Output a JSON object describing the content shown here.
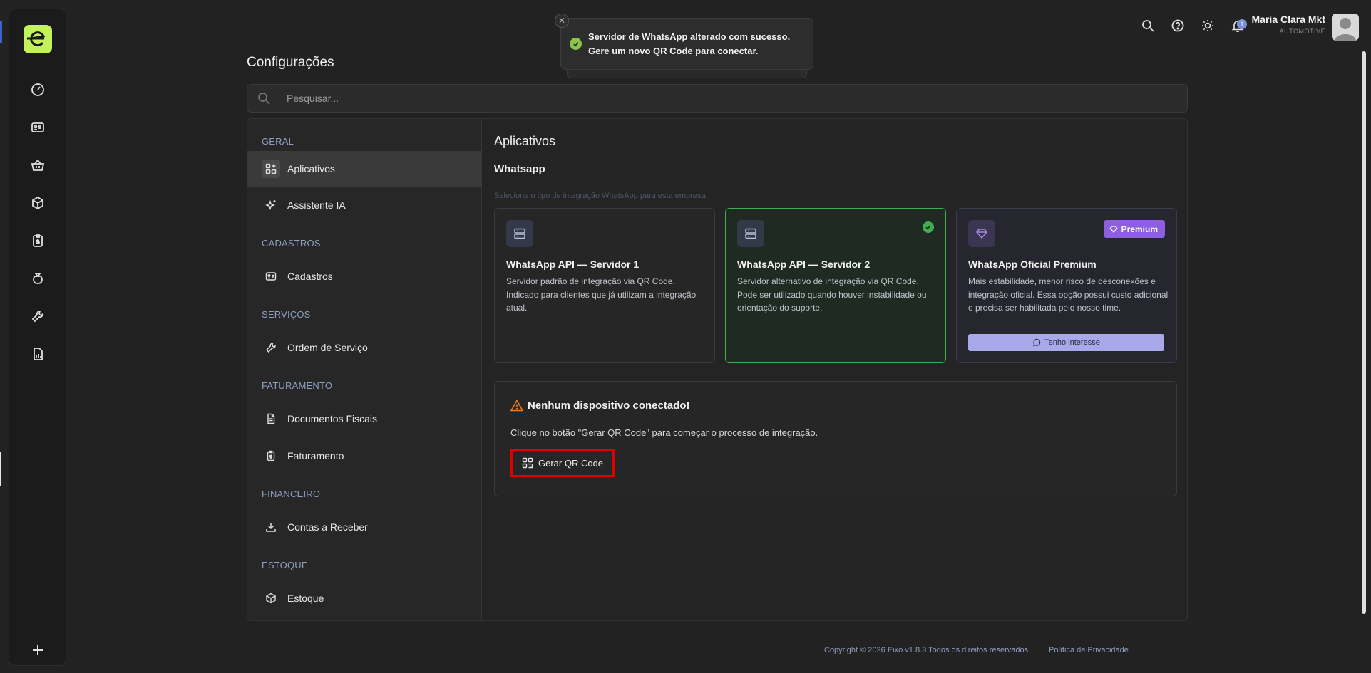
{
  "user": {
    "name": "Maria Clara Mkt",
    "company": "AUTOMOTIVE",
    "notifications": "1"
  },
  "toast": {
    "message": "Servidor de WhatsApp alterado com sucesso. Gere um novo QR Code para conectar.",
    "close": "✕"
  },
  "page": {
    "title": "Configurações"
  },
  "search": {
    "placeholder": "Pesquisar..."
  },
  "sidebar": {
    "sections": [
      {
        "label": "GERAL"
      },
      {
        "label": "CADASTROS"
      },
      {
        "label": "SERVIÇOS"
      },
      {
        "label": "FATURAMENTO"
      },
      {
        "label": "FINANCEIRO"
      },
      {
        "label": "ESTOQUE"
      }
    ],
    "items": [
      {
        "label": "Aplicativos",
        "icon": "apps-icon"
      },
      {
        "label": "Assistente IA",
        "icon": "sparkles-icon"
      },
      {
        "label": "Cadastros",
        "icon": "id-card-icon"
      },
      {
        "label": "Ordem de Serviço",
        "icon": "wrench-icon"
      },
      {
        "label": "Documentos Fiscais",
        "icon": "document-icon"
      },
      {
        "label": "Faturamento",
        "icon": "invoice-icon"
      },
      {
        "label": "Contas a Receber",
        "icon": "download-icon"
      },
      {
        "label": "Estoque",
        "icon": "box-icon"
      }
    ]
  },
  "content": {
    "title": "Aplicativos",
    "subtitle": "Whatsapp",
    "hint": "Selecione o tipo de integração WhatsApp para esta empresa:",
    "cards": [
      {
        "name": "WhatsApp API — Servidor 1",
        "desc": "Servidor padrão de integração via QR Code. Indicado para clientes que já utilizam a integração atual."
      },
      {
        "name": "WhatsApp API — Servidor 2",
        "desc": "Servidor alternativo de integração via QR Code. Pode ser utilizado quando houver instabilidade ou orientação do suporte."
      },
      {
        "name": "WhatsApp Oficial Premium",
        "desc": "Mais estabilidade, menor risco de desconexões e integração oficial. Essa opção possui custo adicional e precisa ser habilitada pelo nosso time.",
        "badge": "Premium",
        "button": "Tenho interesse"
      }
    ],
    "status": {
      "title": "Nenhum dispositivo conectado!",
      "message": "Clique no botão \"Gerar QR Code\" para começar o processo de integração.",
      "button": "Gerar QR Code"
    }
  },
  "footer": {
    "copyright": "Copyright © 2026 Eixo v1.8.3 Todos os direitos reservados.",
    "privacy": "Política de Privacidade"
  },
  "colors": {
    "accent": "#c4f25b",
    "selected": "#3fae4e",
    "premium": "#8d5fe0",
    "highlight": "#e00000"
  }
}
